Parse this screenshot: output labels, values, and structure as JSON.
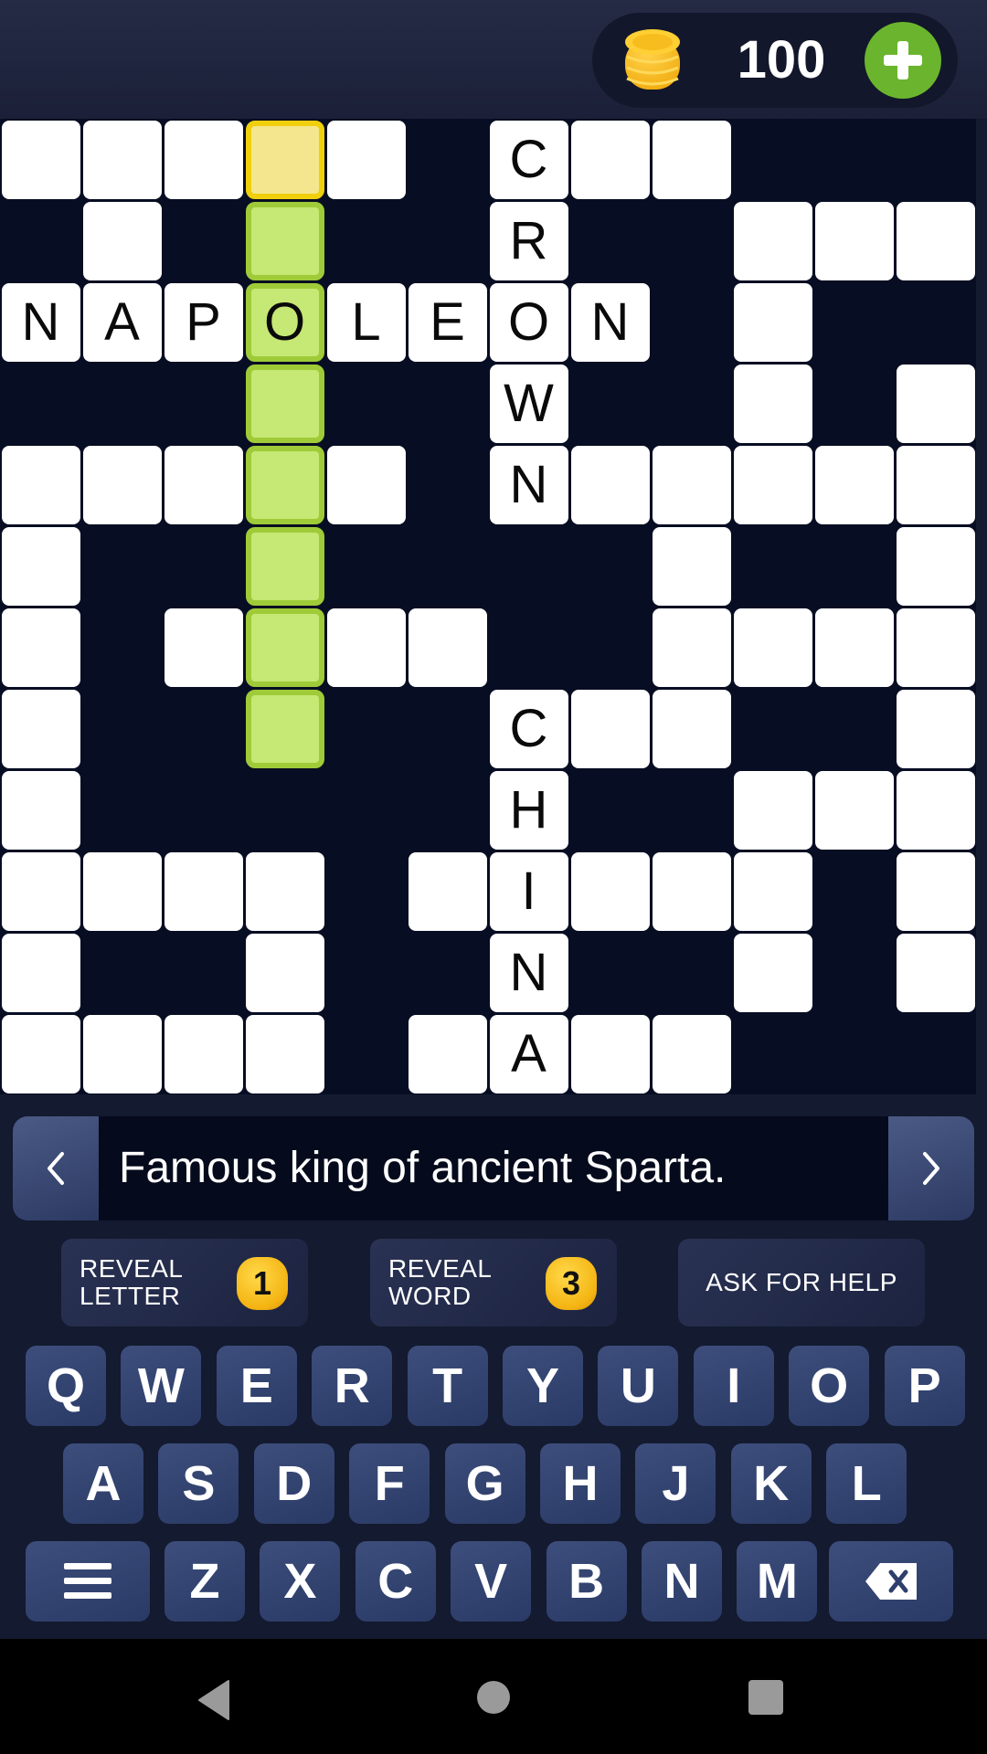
{
  "header": {
    "coin_count": "100",
    "coin_icon": "coin-stack-icon",
    "add_coins_icon": "plus-icon"
  },
  "colors": {
    "highlight_cell": "#c6e874",
    "selected_cell": "#f4e68f",
    "grid_background": "#070d22",
    "add_button": "#6ab52d",
    "key": "#2f3f6c"
  },
  "grid": {
    "rows": 12,
    "cols": 12,
    "selected": [
      0,
      3
    ],
    "highlighted_word_cells": [
      [
        1,
        3
      ],
      [
        2,
        3
      ],
      [
        3,
        3
      ],
      [
        4,
        3
      ],
      [
        5,
        3
      ],
      [
        6,
        3
      ],
      [
        7,
        3
      ]
    ],
    "cells": [
      [
        0,
        0,
        ""
      ],
      [
        0,
        1,
        ""
      ],
      [
        0,
        2,
        ""
      ],
      [
        0,
        3,
        ""
      ],
      [
        0,
        4,
        ""
      ],
      [
        0,
        6,
        "C"
      ],
      [
        0,
        7,
        ""
      ],
      [
        0,
        8,
        ""
      ],
      [
        1,
        1,
        ""
      ],
      [
        1,
        3,
        ""
      ],
      [
        1,
        6,
        "R"
      ],
      [
        1,
        9,
        ""
      ],
      [
        1,
        10,
        ""
      ],
      [
        1,
        11,
        ""
      ],
      [
        2,
        0,
        "N"
      ],
      [
        2,
        1,
        "A"
      ],
      [
        2,
        2,
        "P"
      ],
      [
        2,
        3,
        "O"
      ],
      [
        2,
        4,
        "L"
      ],
      [
        2,
        5,
        "E"
      ],
      [
        2,
        6,
        "O"
      ],
      [
        2,
        7,
        "N"
      ],
      [
        2,
        9,
        ""
      ],
      [
        3,
        3,
        ""
      ],
      [
        3,
        6,
        "W"
      ],
      [
        3,
        9,
        ""
      ],
      [
        3,
        11,
        ""
      ],
      [
        4,
        0,
        ""
      ],
      [
        4,
        1,
        ""
      ],
      [
        4,
        2,
        ""
      ],
      [
        4,
        3,
        ""
      ],
      [
        4,
        4,
        ""
      ],
      [
        4,
        6,
        "N"
      ],
      [
        4,
        7,
        ""
      ],
      [
        4,
        8,
        ""
      ],
      [
        4,
        9,
        ""
      ],
      [
        4,
        10,
        ""
      ],
      [
        4,
        11,
        ""
      ],
      [
        5,
        0,
        ""
      ],
      [
        5,
        3,
        ""
      ],
      [
        5,
        8,
        ""
      ],
      [
        5,
        11,
        ""
      ],
      [
        6,
        0,
        ""
      ],
      [
        6,
        2,
        ""
      ],
      [
        6,
        3,
        ""
      ],
      [
        6,
        4,
        ""
      ],
      [
        6,
        5,
        ""
      ],
      [
        6,
        8,
        ""
      ],
      [
        6,
        9,
        ""
      ],
      [
        6,
        10,
        ""
      ],
      [
        6,
        11,
        ""
      ],
      [
        7,
        0,
        ""
      ],
      [
        7,
        3,
        ""
      ],
      [
        7,
        6,
        "C"
      ],
      [
        7,
        7,
        ""
      ],
      [
        7,
        8,
        ""
      ],
      [
        7,
        11,
        ""
      ],
      [
        8,
        0,
        ""
      ],
      [
        8,
        6,
        "H"
      ],
      [
        8,
        9,
        ""
      ],
      [
        8,
        10,
        ""
      ],
      [
        8,
        11,
        ""
      ],
      [
        9,
        0,
        ""
      ],
      [
        9,
        1,
        ""
      ],
      [
        9,
        2,
        ""
      ],
      [
        9,
        3,
        ""
      ],
      [
        9,
        5,
        ""
      ],
      [
        9,
        6,
        "I"
      ],
      [
        9,
        7,
        ""
      ],
      [
        9,
        8,
        ""
      ],
      [
        9,
        9,
        ""
      ],
      [
        9,
        11,
        ""
      ],
      [
        10,
        0,
        ""
      ],
      [
        10,
        3,
        ""
      ],
      [
        10,
        6,
        "N"
      ],
      [
        10,
        9,
        ""
      ],
      [
        10,
        11,
        ""
      ],
      [
        11,
        0,
        ""
      ],
      [
        11,
        1,
        ""
      ],
      [
        11,
        2,
        ""
      ],
      [
        11,
        3,
        ""
      ],
      [
        11,
        5,
        ""
      ],
      [
        11,
        6,
        "A"
      ],
      [
        11,
        7,
        ""
      ],
      [
        11,
        8,
        ""
      ]
    ]
  },
  "clue": {
    "text": "Famous king of ancient Sparta.",
    "prev_icon": "chevron-left-icon",
    "next_icon": "chevron-right-icon"
  },
  "hints": {
    "reveal_letter": {
      "label": "REVEAL\nLETTER",
      "cost": "1"
    },
    "reveal_word": {
      "label": "REVEAL\nWORD",
      "cost": "3"
    },
    "ask_for_help": {
      "label": "ASK FOR HELP"
    }
  },
  "keyboard": {
    "row1": [
      "Q",
      "W",
      "E",
      "R",
      "T",
      "Y",
      "U",
      "I",
      "O",
      "P"
    ],
    "row2": [
      "A",
      "S",
      "D",
      "F",
      "G",
      "H",
      "J",
      "K",
      "L"
    ],
    "row3": [
      "Z",
      "X",
      "C",
      "V",
      "B",
      "N",
      "M"
    ],
    "menu_icon": "menu-icon",
    "backspace_icon": "backspace-icon"
  },
  "system_nav": {
    "back": "back-icon",
    "home": "home-icon",
    "recents": "recents-icon"
  }
}
